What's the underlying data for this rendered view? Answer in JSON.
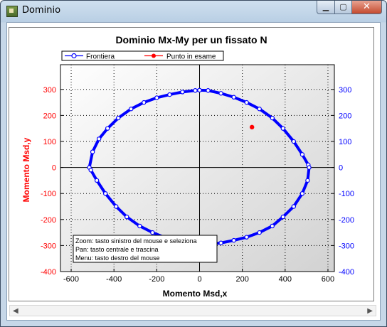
{
  "window": {
    "title": "Dominio",
    "close_glyph": "✕",
    "minimize_glyph": "▁",
    "maximize_glyph": "▢"
  },
  "chart_data": {
    "type": "scatter",
    "title": "Dominio Mx-My per un fissato N",
    "xlabel": "Momento Msd,x",
    "ylabel": "Momento Msd,y",
    "xlim": [
      -650,
      630
    ],
    "ylim": [
      -400,
      395
    ],
    "xticks": [
      -600,
      -400,
      -200,
      0,
      200,
      400,
      600
    ],
    "yticks": [
      -400,
      -300,
      -200,
      -100,
      0,
      100,
      200,
      300
    ],
    "grid": true,
    "legend_position": "top-left",
    "series": [
      {
        "name": "Frontiera",
        "color": "#0000ff",
        "x": [
          -515,
          -500,
          -470,
          -430,
          -380,
          -320,
          -260,
          -200,
          -140,
          -80,
          -20,
          0,
          40,
          100,
          160,
          220,
          280,
          340,
          390,
          440,
          480,
          508,
          512,
          505,
          480,
          440,
          390,
          340,
          280,
          220,
          160,
          100,
          40,
          0,
          -40,
          -100,
          -160,
          -220,
          -280,
          -340,
          -390,
          -440,
          -480,
          -508
        ],
        "y": [
          0,
          60,
          110,
          150,
          190,
          225,
          250,
          268,
          280,
          290,
          296,
          297,
          296,
          285,
          270,
          250,
          225,
          190,
          150,
          100,
          50,
          10,
          0,
          -50,
          -100,
          -150,
          -190,
          -225,
          -250,
          -268,
          -280,
          -290,
          -296,
          -297,
          -296,
          -285,
          -270,
          -250,
          -225,
          -190,
          -150,
          -100,
          -50,
          -10
        ]
      },
      {
        "name": "Punto in esame",
        "color": "#ff0000",
        "x": [
          245
        ],
        "y": [
          155
        ]
      }
    ],
    "info_box": [
      "Zoom: tasto sinistro del mouse e seleziona",
      "Pan: tasto centrale e trascina",
      "Menu: tasto destro del mouse"
    ]
  }
}
